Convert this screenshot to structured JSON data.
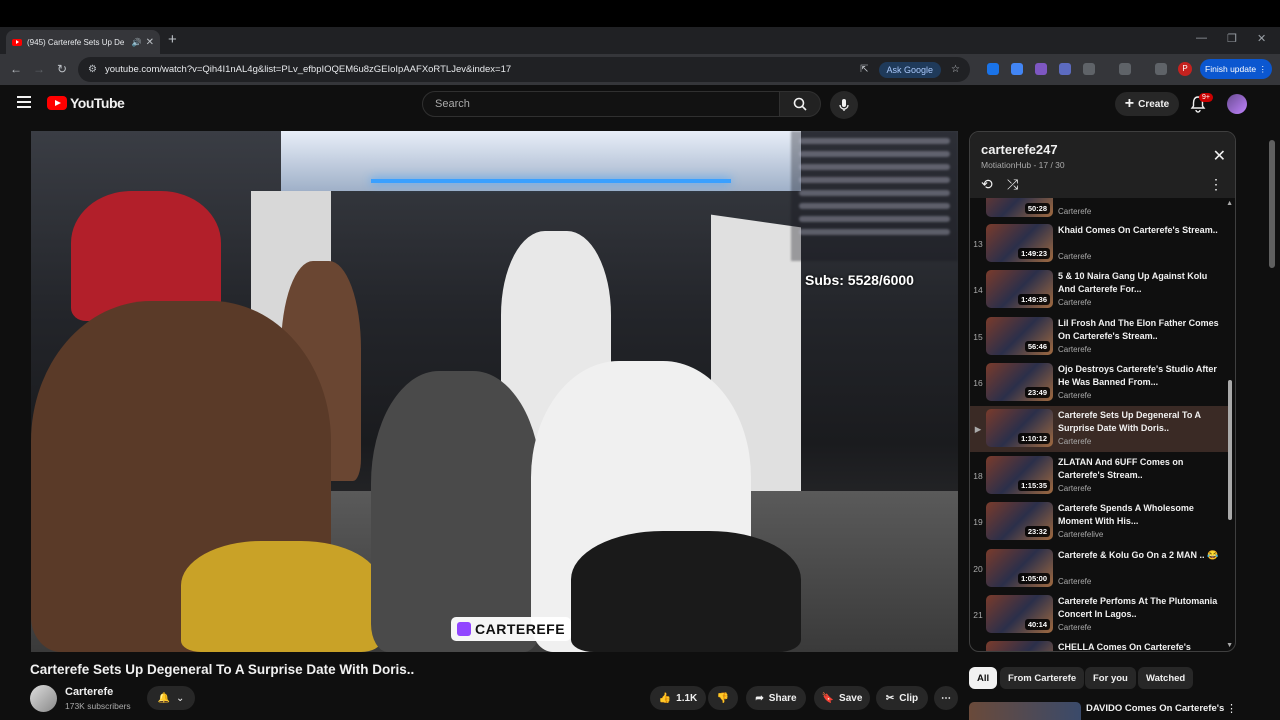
{
  "browser": {
    "tab_title": "(945) Carterefe Sets Up De",
    "url": "youtube.com/watch?v=Qih4I1nAL4g&list=PLv_efbpIOQEM6u8zGEIoIpAAFXoRTLJev&index=17",
    "ask_google": "Ask Google",
    "finish_update": "Finish update",
    "profile_initial": "P"
  },
  "youtube": {
    "logo_text": "YouTube",
    "search_placeholder": "Search",
    "create_label": "Create",
    "notif_badge": "9+"
  },
  "video": {
    "overlay_subs": "Subs: 5528/6000",
    "overlay_brand": "CARTEREFE",
    "title": "Carterefe Sets Up Degeneral To A Surprise Date With Doris..",
    "channel_name": "Carterefe",
    "channel_subs": "173K subscribers",
    "likes": "1.1K",
    "share_label": "Share",
    "save_label": "Save",
    "clip_label": "Clip"
  },
  "playlist": {
    "title": "carterefe247",
    "subtitle": "MotiationHub - 17 / 30",
    "items": [
      {
        "index": "",
        "title": "",
        "channel": "Carterefe",
        "duration": "50:28"
      },
      {
        "index": "13",
        "title": "Khaid Comes On Carterefe's Stream..",
        "channel": "Carterefe",
        "duration": "1:49:23"
      },
      {
        "index": "14",
        "title": "5 & 10 Naira Gang Up Against Kolu And Carterefe For...",
        "channel": "Carterefe",
        "duration": "1:49:36"
      },
      {
        "index": "15",
        "title": "Lil Frosh And The Elon Father Comes On Carterefe's Stream..",
        "channel": "Carterefe",
        "duration": "56:46"
      },
      {
        "index": "16",
        "title": "Ojo Destroys Carterefe's Studio After He Was Banned From...",
        "channel": "Carterefe",
        "duration": "23:49"
      },
      {
        "index": "▶",
        "title": "Carterefe Sets Up Degeneral To A Surprise Date With Doris..",
        "channel": "Carterefe",
        "duration": "1:10:12"
      },
      {
        "index": "18",
        "title": "ZLATAN And 6UFF Comes on Carterefe's Stream..",
        "channel": "Carterefe",
        "duration": "1:15:35"
      },
      {
        "index": "19",
        "title": "Carterefe Spends A Wholesome Moment With His...",
        "channel": "Carterefelive",
        "duration": "23:32"
      },
      {
        "index": "20",
        "title": "Carterefe & Kolu Go On a 2 MAN .. 😂",
        "channel": "Carterefe",
        "duration": "1:05:00"
      },
      {
        "index": "21",
        "title": "Carterefe Perfoms At The Plutomania Concert In Lagos..",
        "channel": "Carterefe",
        "duration": "40:14"
      },
      {
        "index": "",
        "title": "CHELLA Comes On Carterefe's",
        "channel": "",
        "duration": ""
      }
    ]
  },
  "chips": [
    "All",
    "From Carterefe",
    "For you",
    "Watched"
  ],
  "next_video": {
    "title": "DAVIDO Comes On Carterefe's"
  },
  "colors": {
    "accent_red": "#ff0000",
    "active_row": "#3a2a25",
    "chrome_blue": "#0b57d0"
  }
}
